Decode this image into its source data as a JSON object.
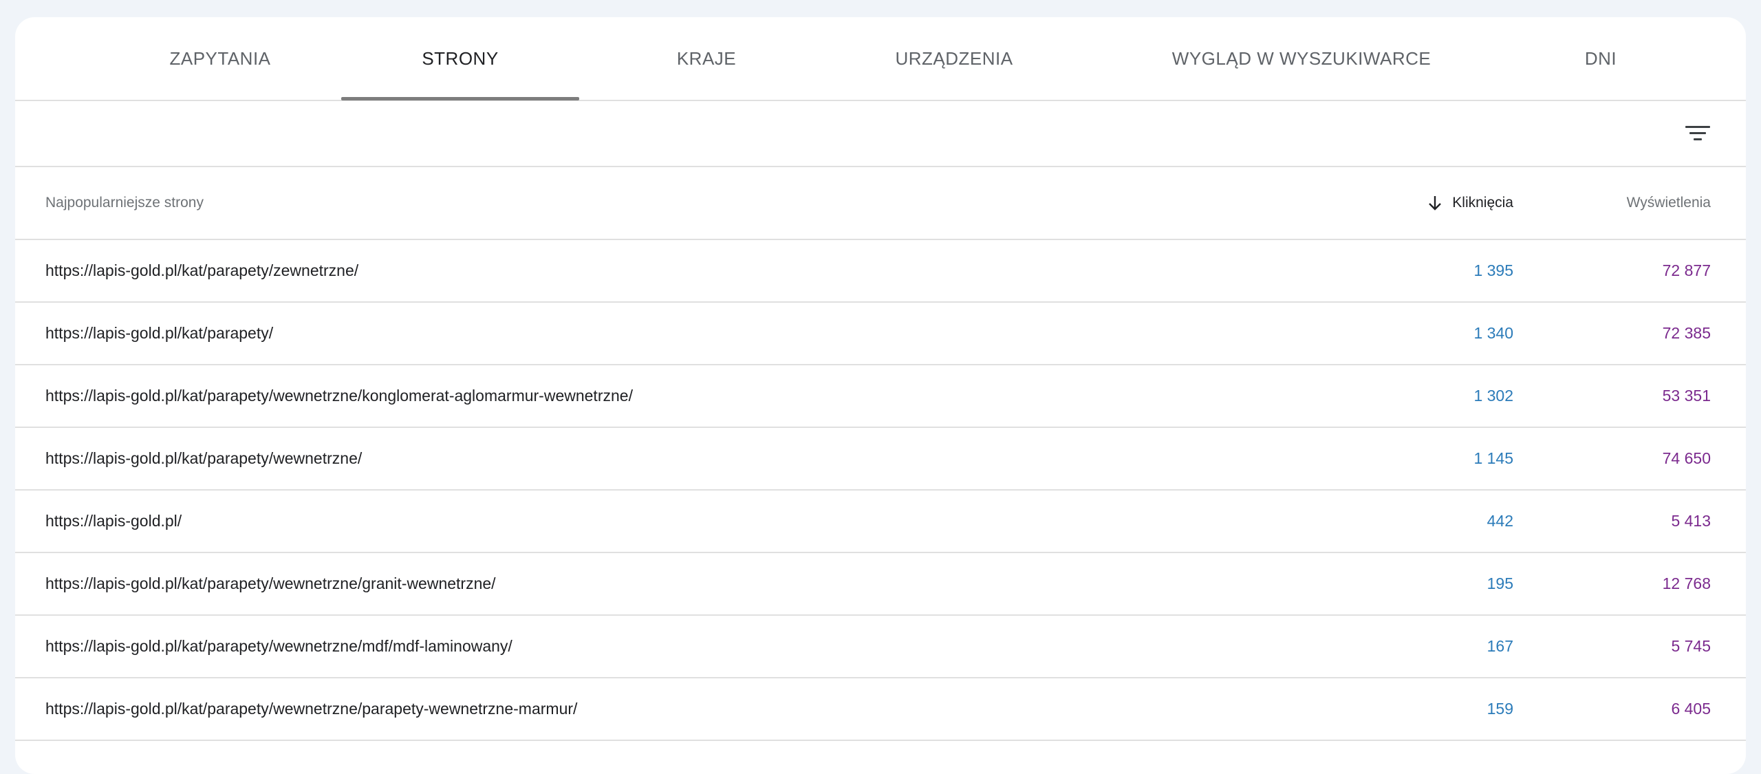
{
  "tabs": [
    {
      "label": "ZAPYTANIA"
    },
    {
      "label": "STRONY"
    },
    {
      "label": "KRAJE"
    },
    {
      "label": "URZĄDZENIA"
    },
    {
      "label": "WYGLĄD W WYSZUKIWARCE"
    },
    {
      "label": "DNI"
    }
  ],
  "active_tab": "STRONY",
  "toolbar": {
    "filter_icon": "filter-icon"
  },
  "table": {
    "headers": {
      "page": "Najpopularniejsze strony",
      "clicks": "Kliknięcia",
      "views": "Wyświetlenia",
      "sort_icon": "arrow-down-icon"
    },
    "rows": [
      {
        "url": "https://lapis-gold.pl/kat/parapety/zewnetrzne/",
        "clicks": "1 395",
        "views": "72 877"
      },
      {
        "url": "https://lapis-gold.pl/kat/parapety/",
        "clicks": "1 340",
        "views": "72 385"
      },
      {
        "url": "https://lapis-gold.pl/kat/parapety/wewnetrzne/konglomerat-aglomarmur-wewnetrzne/",
        "clicks": "1 302",
        "views": "53 351"
      },
      {
        "url": "https://lapis-gold.pl/kat/parapety/wewnetrzne/",
        "clicks": "1 145",
        "views": "74 650"
      },
      {
        "url": "https://lapis-gold.pl/",
        "clicks": "442",
        "views": "5 413"
      },
      {
        "url": "https://lapis-gold.pl/kat/parapety/wewnetrzne/granit-wewnetrzne/",
        "clicks": "195",
        "views": "12 768"
      },
      {
        "url": "https://lapis-gold.pl/kat/parapety/wewnetrzne/mdf/mdf-laminowany/",
        "clicks": "167",
        "views": "5 745"
      },
      {
        "url": "https://lapis-gold.pl/kat/parapety/wewnetrzne/parapety-wewnetrzne-marmur/",
        "clicks": "159",
        "views": "6 405"
      }
    ]
  },
  "colors": {
    "clicks": "#2b7bb9",
    "views": "#7b2a8e",
    "tab_indicator": "#7d7d7d"
  }
}
